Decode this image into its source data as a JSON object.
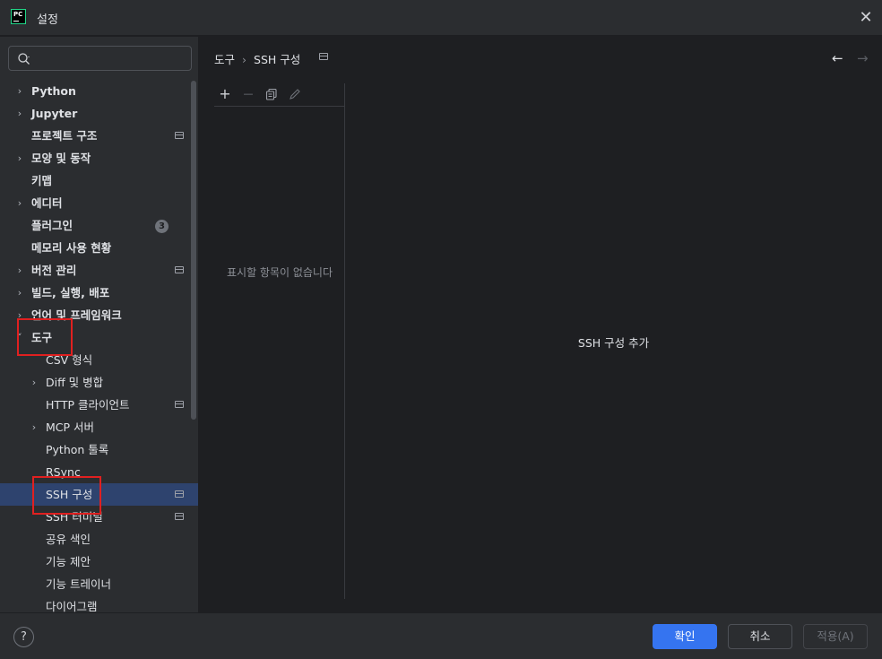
{
  "window": {
    "app_logo_text": "PC",
    "title": "설정",
    "close_glyph": "✕"
  },
  "search": {
    "placeholder": "",
    "value": ""
  },
  "tree": [
    {
      "label": "Python",
      "chevron": "›",
      "expanded": false
    },
    {
      "label": "Jupyter",
      "chevron": "›",
      "expanded": false
    },
    {
      "label": "프로젝트 구조"
    },
    {
      "label": "모양 및 동작",
      "chevron": "›"
    },
    {
      "label": "키맵"
    },
    {
      "label": "에디터",
      "chevron": "›"
    },
    {
      "label": "플러그인",
      "badge": "3"
    },
    {
      "label": "메모리 사용 현황"
    },
    {
      "label": "버전 관리",
      "chevron": "›"
    },
    {
      "label": "빌드, 실행, 배포",
      "chevron": "›"
    },
    {
      "label": "언어 및 프레임워크",
      "chevron": "›"
    },
    {
      "label": "도구",
      "chevron": "˅",
      "expanded": true
    },
    {
      "label": "CSV 형식"
    },
    {
      "label": "Diff 및 병합",
      "chevron": "›"
    },
    {
      "label": "HTTP 클라이언트"
    },
    {
      "label": "MCP 서버",
      "chevron": "›"
    },
    {
      "label": "Python 툴록"
    },
    {
      "label": "RSync"
    },
    {
      "label": "SSH 구성",
      "selected": true
    },
    {
      "label": "SSH 터미널"
    },
    {
      "label": "공유 색인"
    },
    {
      "label": "기능 제안"
    },
    {
      "label": "기능 트레이너"
    },
    {
      "label": "다이어그램"
    }
  ],
  "breadcrumb": {
    "parent": "도구",
    "separator": "›",
    "current": "SSH 구성"
  },
  "nav": {
    "back_glyph": "←",
    "forward_glyph": "→"
  },
  "toolbar": {
    "add_glyph": "+",
    "remove_glyph": "—",
    "copy_icon": "copy-icon",
    "edit_icon": "edit-icon"
  },
  "list": {
    "empty_text": "표시할 항목이 없습니다"
  },
  "detail": {
    "add_text": "SSH 구성 추가"
  },
  "footer": {
    "help_glyph": "?",
    "ok_label": "확인",
    "cancel_label": "취소",
    "apply_label": "적용(A)"
  },
  "colors": {
    "accent": "#3574f0",
    "selection": "#2e436e",
    "highlight": "#e02020",
    "background": "#1e1f22",
    "panel": "#2b2d30"
  }
}
